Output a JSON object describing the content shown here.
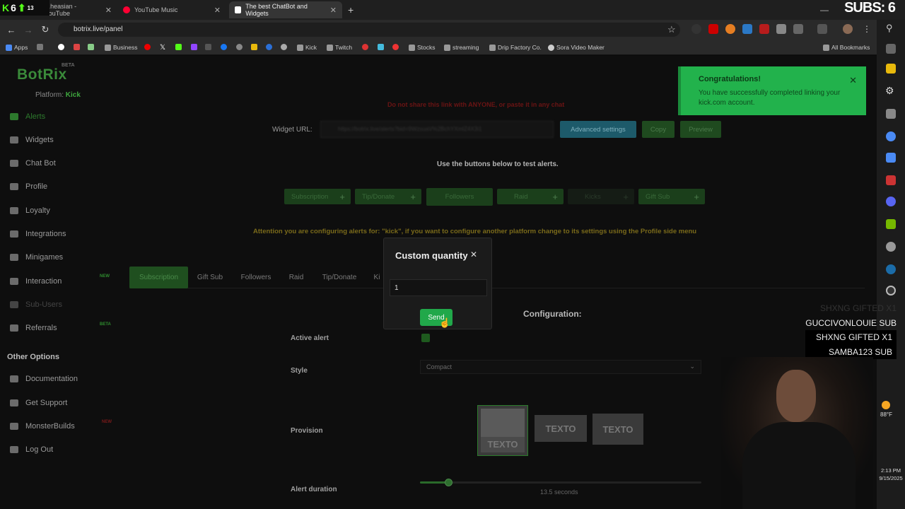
{
  "overlay": {
    "kick_count": "6",
    "arrow_count": "13",
    "subs_label": "SUBS: 6"
  },
  "tabs": [
    {
      "label": "...heasian - YouTube",
      "color": "#cc0000"
    },
    {
      "label": "YouTube Music",
      "color": "#ff0033"
    },
    {
      "label": "The best ChatBot and Widgets",
      "color": "#ffffff"
    }
  ],
  "address": {
    "url": "botrix.live/panel"
  },
  "bookmarks": [
    {
      "label": "Apps"
    },
    {
      "label": ""
    },
    {
      "label": ""
    },
    {
      "label": "Business"
    },
    {
      "label": ""
    },
    {
      "label": ""
    },
    {
      "label": "Kick"
    },
    {
      "label": "Twitch"
    },
    {
      "label": "Stocks"
    },
    {
      "label": "streaming"
    },
    {
      "label": "Drip Factory Co."
    },
    {
      "label": "Sora Video Maker"
    },
    {
      "label": "All Bookmarks"
    }
  ],
  "sidebar": {
    "logo": "BotRix",
    "logo_badge": "BETA",
    "platform_label": "Platform:",
    "platform_value": "Kick",
    "items": [
      {
        "label": "Alerts"
      },
      {
        "label": "Widgets"
      },
      {
        "label": "Chat Bot"
      },
      {
        "label": "Profile"
      },
      {
        "label": "Loyalty"
      },
      {
        "label": "Integrations"
      },
      {
        "label": "Minigames"
      },
      {
        "label": "Interaction",
        "badge": "NEW"
      },
      {
        "label": "Sub-Users"
      },
      {
        "label": "Referrals",
        "badge": "BETA"
      }
    ],
    "other_title": "Other Options",
    "other_items": [
      {
        "label": "Documentation"
      },
      {
        "label": "Get Support"
      },
      {
        "label": "MonsterBuilds",
        "badge": "NEW"
      },
      {
        "label": "Log Out"
      }
    ]
  },
  "main": {
    "warning": "Do not share this link with ANYONE, or paste it in any chat",
    "widget_url_label": "Widget URL:",
    "widget_url_value": "https://botrix.live/alerts?bid=9WzsuaV%2BchYXmlZ4X3i1",
    "advanced_btn": "Advanced settings",
    "copy_btn": "Copy",
    "preview_btn": "Preview",
    "test_text": "Use the buttons below to test alerts.",
    "test_buttons": [
      {
        "label": "Subscription"
      },
      {
        "label": "Tip/Donate"
      },
      {
        "label": "Followers"
      },
      {
        "label": "Raid"
      },
      {
        "label": "Kicks"
      },
      {
        "label": "Gift Sub"
      }
    ],
    "attention": "Attention you are configuring alerts for: \"kick\", if you want to configure another platform change to its settings using the Profile side menu",
    "config_tabs": [
      {
        "label": "Subscription"
      },
      {
        "label": "Gift Sub"
      },
      {
        "label": "Followers"
      },
      {
        "label": "Raid"
      },
      {
        "label": "Tip/Donate"
      },
      {
        "label": "Ki"
      }
    ],
    "config_title": "Configuration:",
    "active_alert_label": "Active alert",
    "style_label": "Style",
    "style_value": "Compact",
    "provision_label": "Provision",
    "provision_text": "TEXTO",
    "duration_label": "Alert duration",
    "duration_value": "13.5 seconds",
    "duration_fraction": 0.1
  },
  "modal": {
    "title": "Custom quantity",
    "quantity": "1",
    "send_label": "Send"
  },
  "toast": {
    "title": "Congratulations!",
    "message": "You have successfully completed linking your kick.com account."
  },
  "alerts_feed": [
    {
      "text": "SHXNG  GIFTED X1"
    },
    {
      "text": "GUCCIVONLOUIE  SUB"
    },
    {
      "text": "SHXNG  GIFTED X1"
    },
    {
      "text": "SAMBA123  SUB"
    }
  ],
  "weather": {
    "temp": "88°F"
  },
  "clock": {
    "time": "2:13 PM",
    "date": "9/15/2025"
  },
  "colors": {
    "accent_green": "#21a84a",
    "kick_green": "#53fc18",
    "toast_bg": "#22b24c"
  }
}
